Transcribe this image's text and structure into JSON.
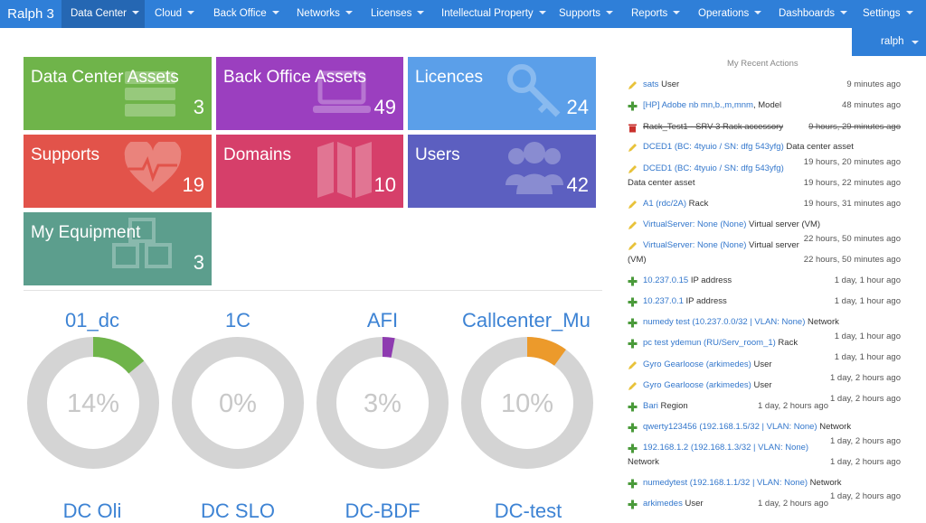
{
  "nav": {
    "brand": "Ralph 3",
    "items": [
      {
        "label": "Data Center"
      },
      {
        "label": "Cloud"
      },
      {
        "label": "Back Office"
      },
      {
        "label": "Networks"
      },
      {
        "label": "Licenses"
      },
      {
        "label": "Intellectual Property"
      },
      {
        "label": "Supports"
      },
      {
        "label": "Reports"
      },
      {
        "label": "Operations"
      },
      {
        "label": "Dashboards"
      },
      {
        "label": "Settings"
      }
    ],
    "user": "ralph"
  },
  "tiles": [
    {
      "title": "Data Center Assets",
      "count": "3",
      "color": "#6fb44a"
    },
    {
      "title": "Back Office Assets",
      "count": "49",
      "color": "#9b3fbf"
    },
    {
      "title": "Licences",
      "count": "24",
      "color": "#5b9fe9"
    },
    {
      "title": "Supports",
      "count": "19",
      "color": "#e2534a"
    },
    {
      "title": "Domains",
      "count": "10",
      "color": "#d63f6a"
    },
    {
      "title": "Users",
      "count": "42",
      "color": "#5c5fc0"
    },
    {
      "title": "My Equipment",
      "count": "3",
      "color": "#5c9e8d"
    }
  ],
  "donuts": [
    {
      "title": "01_dc",
      "percent_label": "14%",
      "percent": 14,
      "color": "#6fb44a"
    },
    {
      "title": "1C",
      "percent_label": "0%",
      "percent": 0,
      "color": "#cccccc"
    },
    {
      "title": "AFI",
      "percent_label": "3%",
      "percent": 3,
      "color": "#8e3bb0"
    },
    {
      "title": "Callcenter_Mu",
      "percent_label": "10%",
      "percent": 10,
      "color": "#ec9a2b"
    }
  ],
  "donuts_bottom": [
    "DC Oli",
    "DC SLO",
    "DC-BDF",
    "DC-test"
  ],
  "actions": {
    "title": "My Recent Actions",
    "items": [
      {
        "icon": "pencil",
        "link": "sats",
        "text": " User",
        "time": "9 minutes ago"
      },
      {
        "icon": "plus",
        "link": "[HP] Adobe nb mn,b.,m,mnm",
        "text": ", Model",
        "time": "48 minutes ago"
      },
      {
        "icon": "trash",
        "link": "Rack_Test1 - SRV 3",
        "text": " Rack accessory",
        "time": "9 hours, 29 minutes ago",
        "deleted": true
      },
      {
        "icon": "pencil",
        "link": "DCED1 (BC: 4tyuio / SN: dfg 543yfg)",
        "text": " Data center asset",
        "time": "19 hours, 20 minutes ago"
      },
      {
        "icon": "pencil",
        "link": "DCED1 (BC: 4tyuio / SN: dfg 543yfg)",
        "text": "Data center asset",
        "time": "19 hours, 22 minutes ago"
      },
      {
        "icon": "pencil",
        "link": "A1 (rdc/2A)",
        "text": " Rack",
        "time": "19 hours, 31 minutes ago"
      },
      {
        "icon": "pencil",
        "link": "VirtualServer: None (None)",
        "text": " Virtual server (VM)",
        "time": "22 hours, 50 minutes ago"
      },
      {
        "icon": "pencil",
        "link": "VirtualServer: None (None)",
        "text": " Virtual server",
        "text2": "(VM)",
        "time": "22 hours, 50 minutes ago"
      },
      {
        "icon": "plus",
        "link": "10.237.0.15",
        "text": " IP address",
        "time": "1 day, 1 hour ago"
      },
      {
        "icon": "plus",
        "link": "10.237.0.1",
        "text": " IP address",
        "time": "1 day, 1 hour ago"
      },
      {
        "icon": "plus",
        "link": "numedy test (10.237.0.0/32 | VLAN: None)",
        "text": " Network",
        "time": "1 day, 1 hour ago"
      },
      {
        "icon": "plus",
        "link": "pc test ydemun (RU/Serv_room_1)",
        "text": " Rack",
        "time": "1 day, 1 hour ago"
      },
      {
        "icon": "pencil",
        "link": "Gyro Gearloose (arkimedes)",
        "text": " User",
        "time": "1 day, 2 hours ago"
      },
      {
        "icon": "pencil",
        "link": "Gyro Gearloose (arkimedes)",
        "text": " User",
        "time": "1 day, 2 hours ago"
      },
      {
        "icon": "plus",
        "link": "Bari",
        "text": " Region",
        "time": "1 day, 2 hours ago"
      },
      {
        "icon": "plus",
        "link": "qwerty123456 (192.168.1.5/32 | VLAN: None)",
        "text": " Network",
        "time": "1 day, 2 hours ago"
      },
      {
        "icon": "plus",
        "link": "192.168.1.2 (192.168.1.3/32 | VLAN: None)",
        "text": "Network",
        "time": "1 day, 2 hours ago"
      },
      {
        "icon": "plus",
        "link": "numedytest (192.168.1.1/32 | VLAN: None)",
        "text": " Network",
        "time": "1 day, 2 hours ago"
      },
      {
        "icon": "plus",
        "link": "arkimedes",
        "text": " User",
        "time": "1 day, 2 hours ago"
      }
    ]
  },
  "colors": {
    "nav": "#2f7fd8",
    "nav_active": "#2567b3",
    "link": "#3377cc",
    "plus": "#4a9a3a",
    "pencil": "#e8c23a",
    "trash": "#c9302c"
  }
}
